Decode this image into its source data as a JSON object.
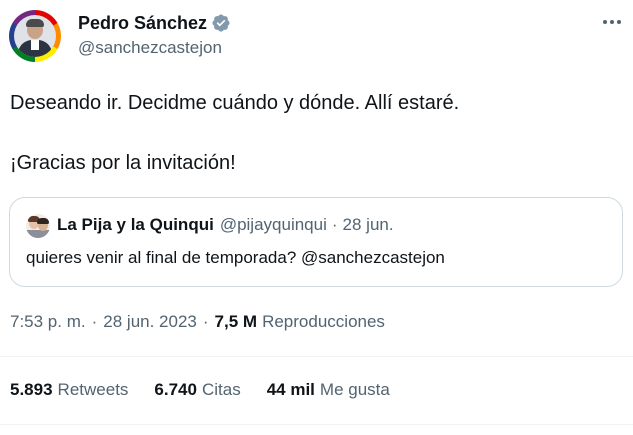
{
  "author": {
    "display_name": "Pedro Sánchez",
    "handle": "@sanchezcastejon",
    "verified": true
  },
  "tweet": {
    "line1": "Deseando ir. Decidme cuándo y dónde. Allí estaré.",
    "line2": "¡Gracias por la invitación!"
  },
  "quote": {
    "display_name": "La Pija y la Quinqui",
    "handle": "@pijayquinqui",
    "separator": "·",
    "date": "28 jun.",
    "text": "quieres venir al final de temporada? @sanchezcastejon"
  },
  "meta": {
    "time": "7:53 p. m.",
    "separator": "·",
    "date": "28 jun. 2023",
    "views_count": "7,5 M",
    "views_label": "Reproducciones"
  },
  "stats": [
    {
      "count": "5.893",
      "label": "Retweets"
    },
    {
      "count": "6.740",
      "label": "Citas"
    },
    {
      "count": "44 mil",
      "label": "Me gusta"
    }
  ],
  "icons": {
    "verified": "verified-badge-icon",
    "more": "more-options-icon"
  },
  "colors": {
    "text_primary": "#0f1419",
    "text_secondary": "#536471",
    "border": "#cfd9de",
    "divider": "#eff3f4",
    "verified_badge": "#829aab"
  }
}
